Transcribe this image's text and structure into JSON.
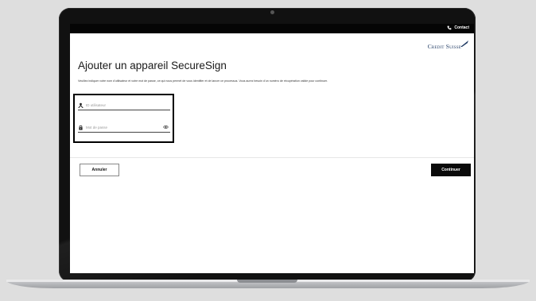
{
  "header": {
    "contact_label": "Contact"
  },
  "brand": {
    "logo_text": "Credit Suisse",
    "accent_color": "#1f3a63"
  },
  "page": {
    "title": "Ajouter un appareil SecureSign",
    "description": "Veuillez indiquer votre nom d'utilisateur et votre mot de passe, ce qui nous permet de vous identifier et de lancer ce processus. Vous aurez besoin d'un numéro de récupération valide pour continuer."
  },
  "form": {
    "username": {
      "placeholder": "ID utilisateur",
      "value": "",
      "icon": "user-icon"
    },
    "password": {
      "placeholder": "Mot de passe",
      "value": "",
      "icon": "lock-icon",
      "toggle_icon": "eye-icon"
    }
  },
  "actions": {
    "cancel_label": "Annuler",
    "continue_label": "Continuer"
  }
}
